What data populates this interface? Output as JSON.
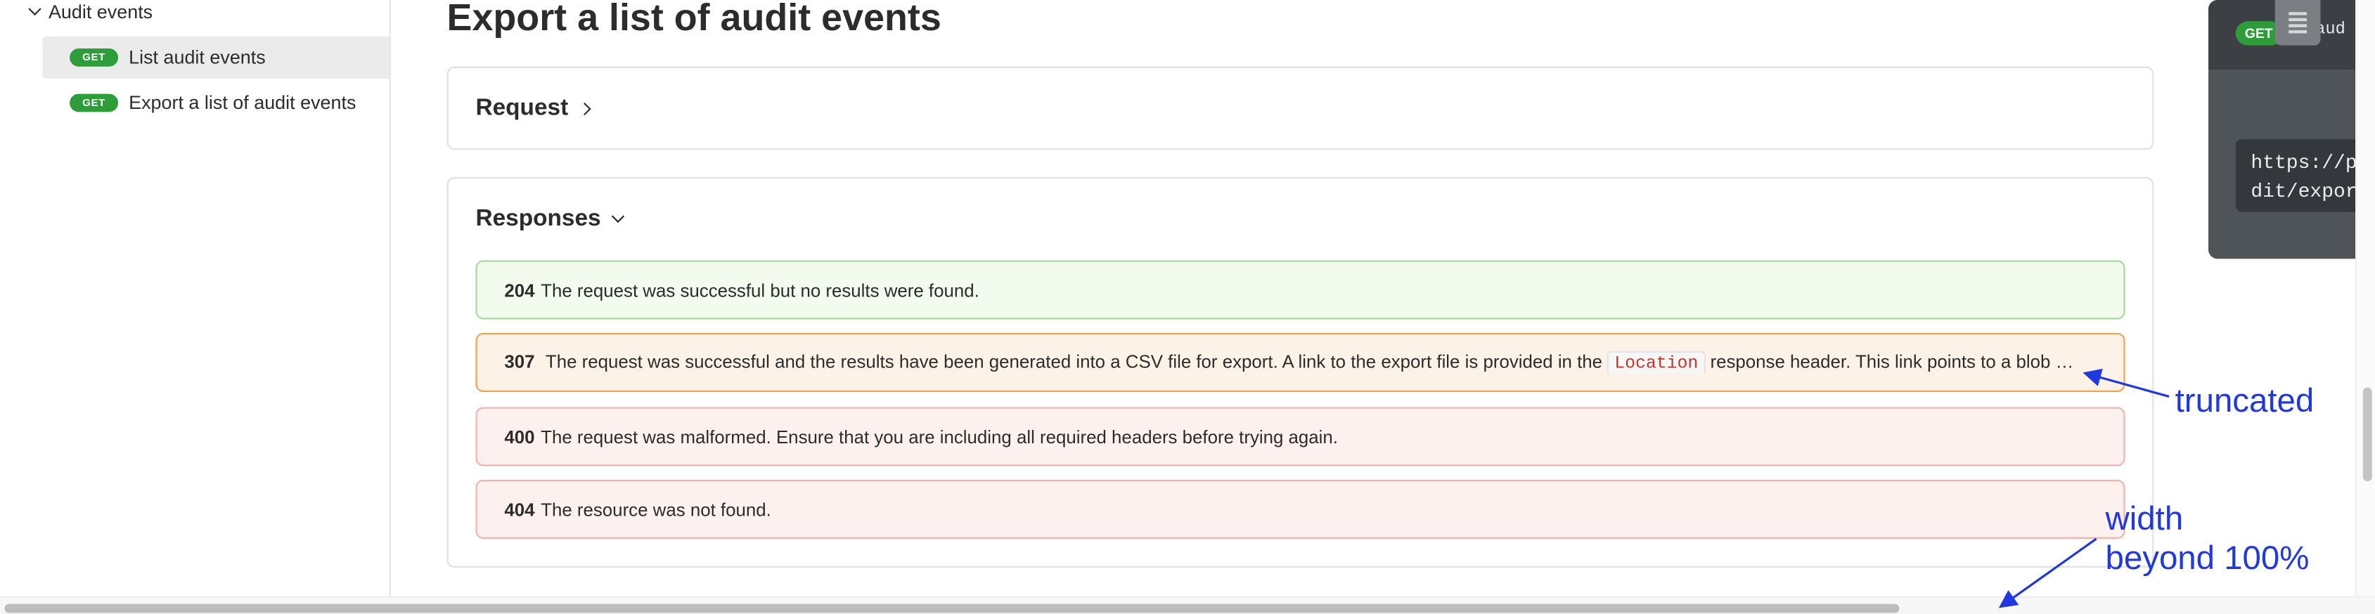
{
  "sidebar": {
    "group_label": "Audit events",
    "items": [
      {
        "method": "GET",
        "label": "List audit events"
      },
      {
        "method": "GET",
        "label": "Export a list of audit events"
      }
    ]
  },
  "main": {
    "title": "Export a list of audit events",
    "request_label": "Request",
    "responses_label": "Responses",
    "responses": [
      {
        "code": "204",
        "text": "The request was successful but no results were found."
      },
      {
        "code": "307",
        "text_before": "The request was successful and the results have been generated into a CSV file for export. A link to the export file is provided in the",
        "inline_code": "Location",
        "text_after": "response header. This link points to a blob storage l…"
      },
      {
        "code": "400",
        "text": "The request was malformed. Ensure that you are including all required headers before trying again."
      },
      {
        "code": "404",
        "text": "The resource was not found."
      }
    ]
  },
  "code_panel": {
    "method": "GET",
    "path": "/aud",
    "url_line1": "https://p",
    "url_line2": "dit/expor"
  },
  "annotations": {
    "truncated": "truncated",
    "width_line1": "width",
    "width_line2": "beyond 100%"
  },
  "colors": {
    "get_pill": "#2d9d3a",
    "annotation": "#1f38e0",
    "status_success_bg": "#f3fbef",
    "status_redirect_bg": "#fdf2e7",
    "status_error_bg": "#fdf1f0"
  },
  "icons": [
    "chevron-down-icon",
    "chevron-right-icon",
    "menu-icon"
  ]
}
